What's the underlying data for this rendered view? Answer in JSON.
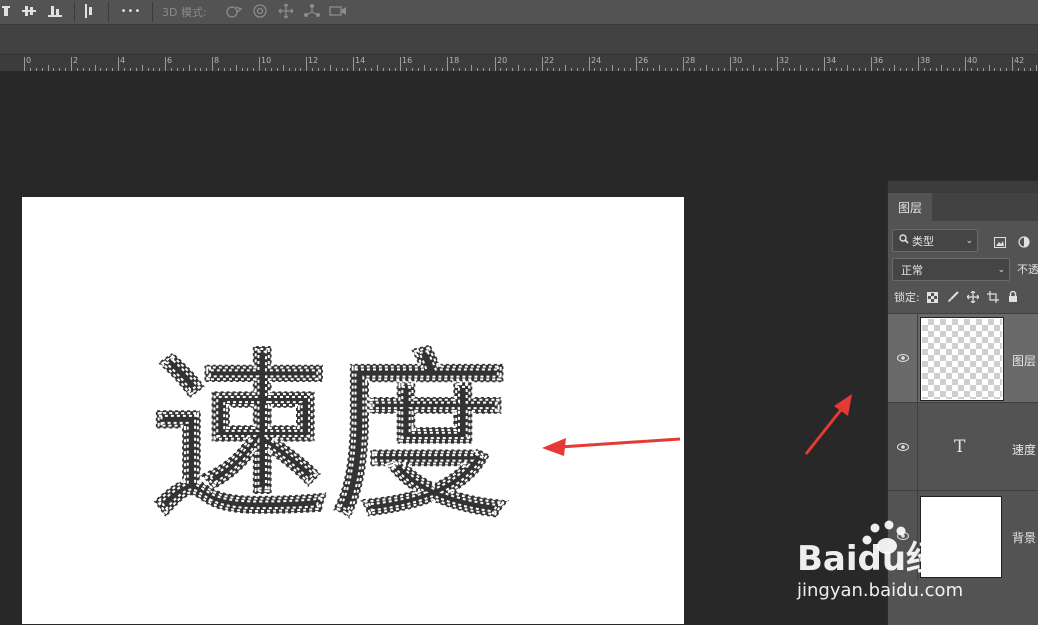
{
  "options_bar": {
    "mode_label": "3D 模式:",
    "more_label": "•••",
    "icons": [
      "align-top-icon",
      "align-vcenter-icon",
      "align-bottom-icon",
      "distribute-icon",
      "orbit-3d-icon",
      "roll-3d-icon",
      "pan-3d-icon",
      "slide-3d-icon",
      "camera-3d-icon"
    ]
  },
  "ruler": {
    "labels": [
      "0",
      "2",
      "4",
      "6",
      "8",
      "10",
      "12",
      "14",
      "16",
      "18",
      "20",
      "22",
      "24",
      "26",
      "28",
      "30",
      "32",
      "34",
      "36",
      "38",
      "40",
      "42"
    ]
  },
  "canvas": {
    "text": "速度"
  },
  "layers_panel": {
    "tab_label": "图层",
    "filter_kind": "类型",
    "blend_mode": "正常",
    "opacity_label": "不透",
    "lock_label": "锁定:",
    "layers": [
      {
        "name": "图层",
        "type": "pixel",
        "selected": true
      },
      {
        "name": "速度",
        "type": "text",
        "selected": false,
        "type_glyph": "T"
      },
      {
        "name": "背景",
        "type": "background",
        "selected": false
      }
    ]
  },
  "watermark": {
    "brand": "Baidu经验",
    "url": "jingyan.baidu.com"
  },
  "colors": {
    "annotation_arrow": "#e53935",
    "workspace": "#282828",
    "panel": "#535353"
  }
}
